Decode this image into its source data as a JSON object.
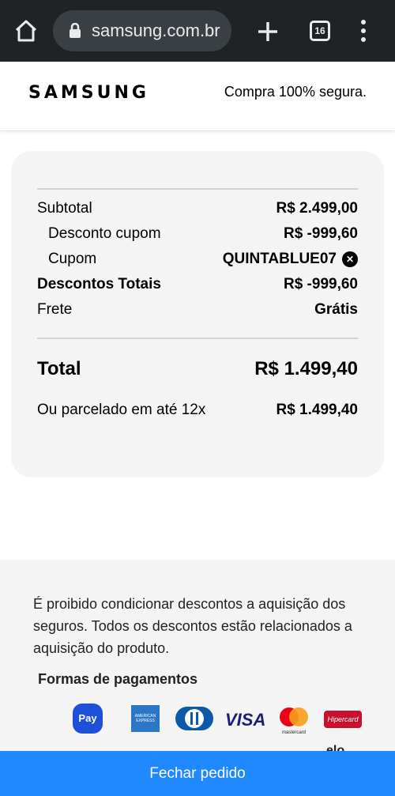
{
  "browser": {
    "url": "samsung.com.br",
    "tab_count": "16"
  },
  "header": {
    "logo": "SAMSUNG",
    "secure_text": "Compra 100% segura."
  },
  "summary": {
    "subtotal_label": "Subtotal",
    "subtotal_value": "R$ 2.499,00",
    "coupon_discount_label": "Desconto cupom",
    "coupon_discount_value": "R$ -999,60",
    "coupon_label": "Cupom",
    "coupon_code": "QUINTABLUE07",
    "total_discounts_label": "Descontos Totais",
    "total_discounts_value": "R$ -999,60",
    "shipping_label": "Frete",
    "shipping_value": "Grátis",
    "total_label": "Total",
    "total_value": "R$ 1.499,40",
    "installments_label": "Ou parcelado em até 12x",
    "installments_value": "R$ 1.499,40"
  },
  "footer": {
    "disclaimer": "É proibido condicionar descontos a aquisição dos seguros. Todos os descontos estão relacionados a aquisição do produto.",
    "payment_title": "Formas de pagamentos",
    "payment_methods": {
      "samsung_pay": "Pay",
      "amex": "AMERICAN EXPRESS",
      "visa": "VISA",
      "mastercard": "mastercard",
      "hipercard": "Hipercard",
      "elo": "elo"
    }
  },
  "checkout_button": "Fechar pedido",
  "colors": {
    "browser_bar": "#1f2326",
    "card_bg": "#f4f4f4",
    "checkout_blue": "#2189ff"
  }
}
